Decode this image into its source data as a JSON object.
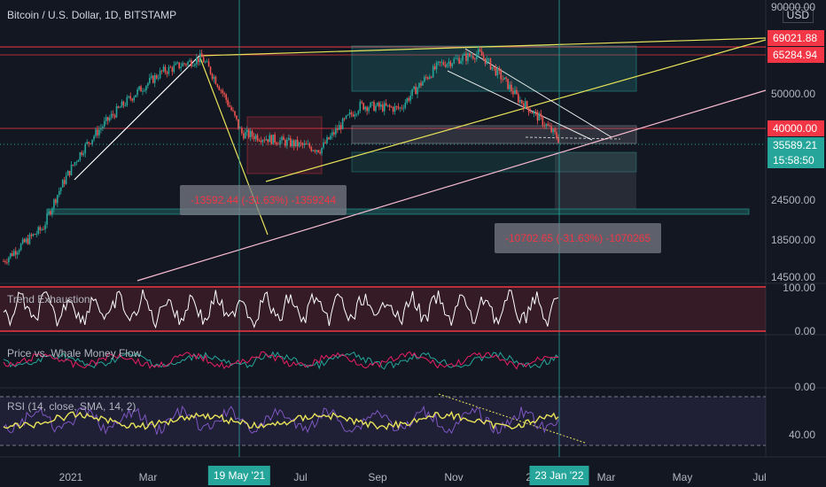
{
  "header": {
    "title": "Bitcoin / U.S. Dollar, 1D, BITSTAMP"
  },
  "price_axis": {
    "currency_button": "USD",
    "ticks": [
      "90000.00",
      "50000.00",
      "24500.00",
      "18500.00",
      "14500.00"
    ],
    "tags": {
      "level_a": "69021.88",
      "level_b": "65284.94",
      "level_c": "40000.00",
      "last_price": "35589.21",
      "countdown": "15:58:50"
    },
    "colors": {
      "red": "#f23645",
      "green": "#26a69a"
    }
  },
  "time_axis": {
    "ticks": [
      "2021",
      "Mar",
      "19 May '21",
      "Jul",
      "Sep",
      "Nov",
      "20",
      "23 Jan '22",
      "Mar",
      "May",
      "Jul"
    ]
  },
  "measurements": {
    "left": "-13592.44 (-31.63%) -1359244",
    "right": "-10702.65 (-31.63%) -1070265"
  },
  "panes": {
    "trend": {
      "title": "Trend Exhaustion",
      "ticks": [
        "100.00",
        "0.00"
      ]
    },
    "whale": {
      "title": "Price vs. Whale Money Flow",
      "ticks": [
        "0.00"
      ]
    },
    "rsi": {
      "title": "RSI (14, close, SMA, 14, 2)",
      "ticks": [
        "40.00"
      ]
    }
  },
  "chart_data": {
    "type": "candlestick",
    "title": "Bitcoin / U.S. Dollar, 1D, BITSTAMP",
    "x": [
      "2020-11",
      "2020-12",
      "2021-01",
      "2021-02",
      "2021-03",
      "2021-04",
      "2021-05",
      "2021-06",
      "2021-07",
      "2021-08",
      "2021-09",
      "2021-10",
      "2021-11",
      "2021-12",
      "2022-01"
    ],
    "series": [
      {
        "values": [
          15000,
          19000,
          33000,
          45000,
          57000,
          63000,
          37000,
          35000,
          33000,
          45000,
          44000,
          60000,
          65000,
          47000,
          35589
        ]
      }
    ],
    "yscale": "log",
    "ylim": [
      13000,
      90000
    ],
    "horizontal_levels": [
      69021.88,
      65284.94,
      40000
    ],
    "indicators": [
      "Trend Exhaustion",
      "Price vs. Whale Money Flow",
      "RSI (14, close, SMA, 14, 2)"
    ]
  }
}
